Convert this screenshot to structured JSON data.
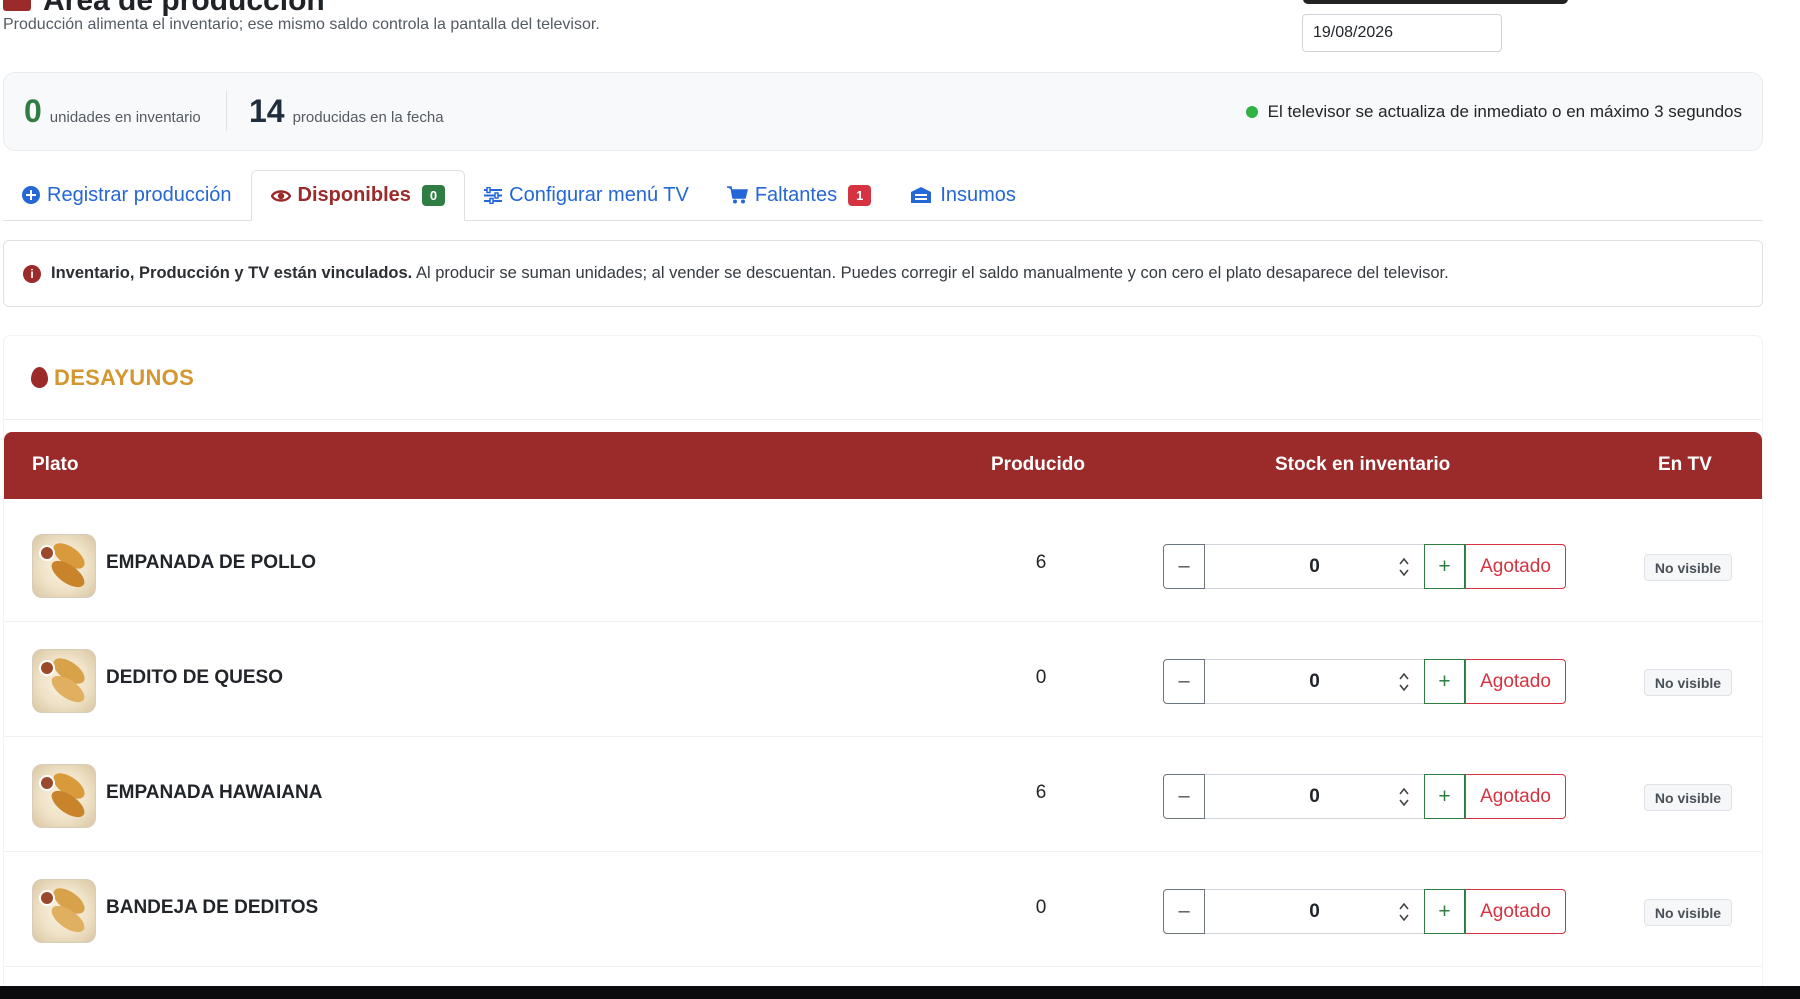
{
  "header": {
    "title": "Área de producción",
    "subtitle": "Producción alimenta el inventario; ese mismo saldo controla la pantalla del televisor.",
    "date_value": "19/08/2026"
  },
  "summary": {
    "inventory_count": "0",
    "inventory_label": "unidades en inventario",
    "produced_count": "14",
    "produced_label": "producidas en la fecha",
    "live_text": "El televisor se actualiza de inmediato o en máximo 3 segundos",
    "live_color": "#2fb344"
  },
  "tabs": [
    {
      "label": "Registrar producción",
      "icon": "plus-circle-icon",
      "active": false
    },
    {
      "label": "Disponibles",
      "icon": "eye-icon",
      "active": true,
      "badge": "0"
    },
    {
      "label": "Configurar menú TV",
      "icon": "sliders-icon",
      "active": false
    },
    {
      "label": "Faltantes",
      "icon": "cart-icon",
      "active": false,
      "badge": "1"
    },
    {
      "label": "Insumos",
      "icon": "box-icon",
      "active": false
    }
  ],
  "alert": {
    "bold": "Inventario, Producción y TV están vinculados.",
    "text": " Al producir se suman unidades; al vender se descuentan. Puedes corregir el saldo manualmente y con cero el plato desaparece del televisor."
  },
  "section": {
    "title": "DESAYUNOS",
    "icon": "egg-icon",
    "columns": {
      "dish": "Plato",
      "produced": "Producido",
      "stock": "Stock en inventario",
      "tv": "En TV"
    },
    "rows": [
      {
        "name": "EMPANADA DE POLLO",
        "produced": "6",
        "stock": "0",
        "minus": "–",
        "plus": "+",
        "sold_out": "Agotado",
        "tv": "No visible"
      },
      {
        "name": "DEDITO DE QUESO",
        "produced": "0",
        "stock": "0",
        "minus": "–",
        "plus": "+",
        "sold_out": "Agotado",
        "tv": "No visible"
      },
      {
        "name": "EMPANADA HAWAIANA",
        "produced": "6",
        "stock": "0",
        "minus": "–",
        "plus": "+",
        "sold_out": "Agotado",
        "tv": "No visible"
      },
      {
        "name": "BANDEJA DE DEDITOS",
        "produced": "0",
        "stock": "0",
        "minus": "–",
        "plus": "+",
        "sold_out": "Agotado",
        "tv": "No visible"
      }
    ]
  },
  "colors": {
    "brand": "#9b2a2a",
    "link": "#2567d6",
    "accent_title": "#d4962f",
    "success": "#2f7d43",
    "danger": "#d63340"
  }
}
